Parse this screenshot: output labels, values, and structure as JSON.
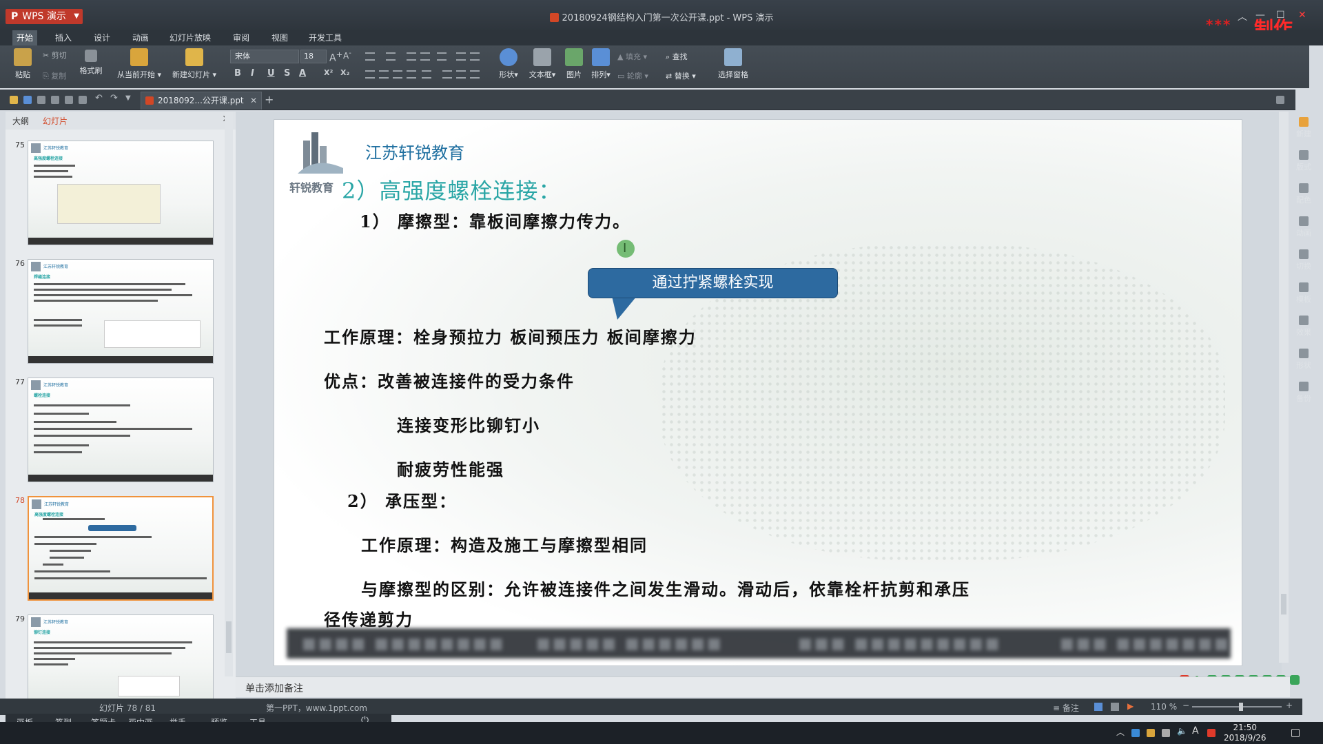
{
  "window": {
    "app_button": "WPS 演示",
    "title": "20180924钢结构入门第一次公开课.ppt - WPS 演示",
    "recording_stars": "***",
    "recording_label": "制作"
  },
  "menu_tabs": [
    "开始",
    "插入",
    "设计",
    "动画",
    "幻灯片放映",
    "审阅",
    "视图",
    "开发工具"
  ],
  "ribbon": {
    "paste": "粘贴",
    "cut": "剪切",
    "copy": "复制",
    "format_painter": "格式刷",
    "from_current": "从当前开始",
    "new_slide": "新建幻灯片",
    "font_name": "宋体",
    "font_size": "18",
    "shape": "形状",
    "textbox": "文本框",
    "picture": "图片",
    "arrange": "排列",
    "fill": "填充",
    "outline": "轮廓",
    "find": "查找",
    "replace": "替换",
    "selection_pane": "选择窗格",
    "format_buttons": [
      "B",
      "I",
      "U",
      "S",
      "A",
      "X²",
      "X₂"
    ]
  },
  "doc_tab": {
    "label": "2018092...公开课.ppt"
  },
  "left_panel": {
    "tab_outline": "大纲",
    "tab_slides": "幻灯片",
    "thumbnails": [
      {
        "num": "75",
        "title": "高强度螺栓连接"
      },
      {
        "num": "76",
        "title": "焊缝连接"
      },
      {
        "num": "77",
        "title": "螺栓连接"
      },
      {
        "num": "78",
        "title": "高强度螺栓连接"
      },
      {
        "num": "79",
        "title": "铆钉连接"
      }
    ]
  },
  "slide": {
    "company": "江苏轩锐教育",
    "logo_text": "轩锐教育",
    "heading": "2）高强度螺栓连接：",
    "line_friction": "1） 摩擦型：靠板间摩擦力传力。",
    "callout": "通过拧紧螺栓实现",
    "principle": "工作原理：栓身预拉力  板间预压力  板间摩擦力",
    "advantage": "优点：改善被连接件的受力条件",
    "advantage2": "连接变形比铆钉小",
    "advantage3": "耐疲劳性能强",
    "line_bearing": "2） 承压型：",
    "bearing_principle": "工作原理：构造及施工与摩擦型相同",
    "difference": "与摩擦型的区别：允许被连接件之间发生滑动。滑动后，依靠栓杆抗剪和承压",
    "difference2": "径传递剪力"
  },
  "right_panel": [
    "新建",
    "版式",
    "配色",
    "动画",
    "切换",
    "模板",
    "效果",
    "形状",
    "备份"
  ],
  "notes": {
    "placeholder": "单击添加备注"
  },
  "status": {
    "slide_info": "幻灯片 78 / 81",
    "theme": "第一PPT，www.1ppt.com",
    "notes_label": "备注",
    "zoom": "110 %",
    "zoom_level": 0.55
  },
  "class_toolbar": [
    "画板",
    "签到",
    "答题卡",
    "画中画",
    "举手",
    "预览",
    "工具"
  ],
  "taskbar": {
    "time": "21:50",
    "date": "2018/9/26"
  },
  "colors": {
    "accent": "#d24726",
    "heading_teal": "#2aa6a6",
    "company_blue": "#1f6fa0",
    "callout_blue": "#2d6aa0"
  }
}
